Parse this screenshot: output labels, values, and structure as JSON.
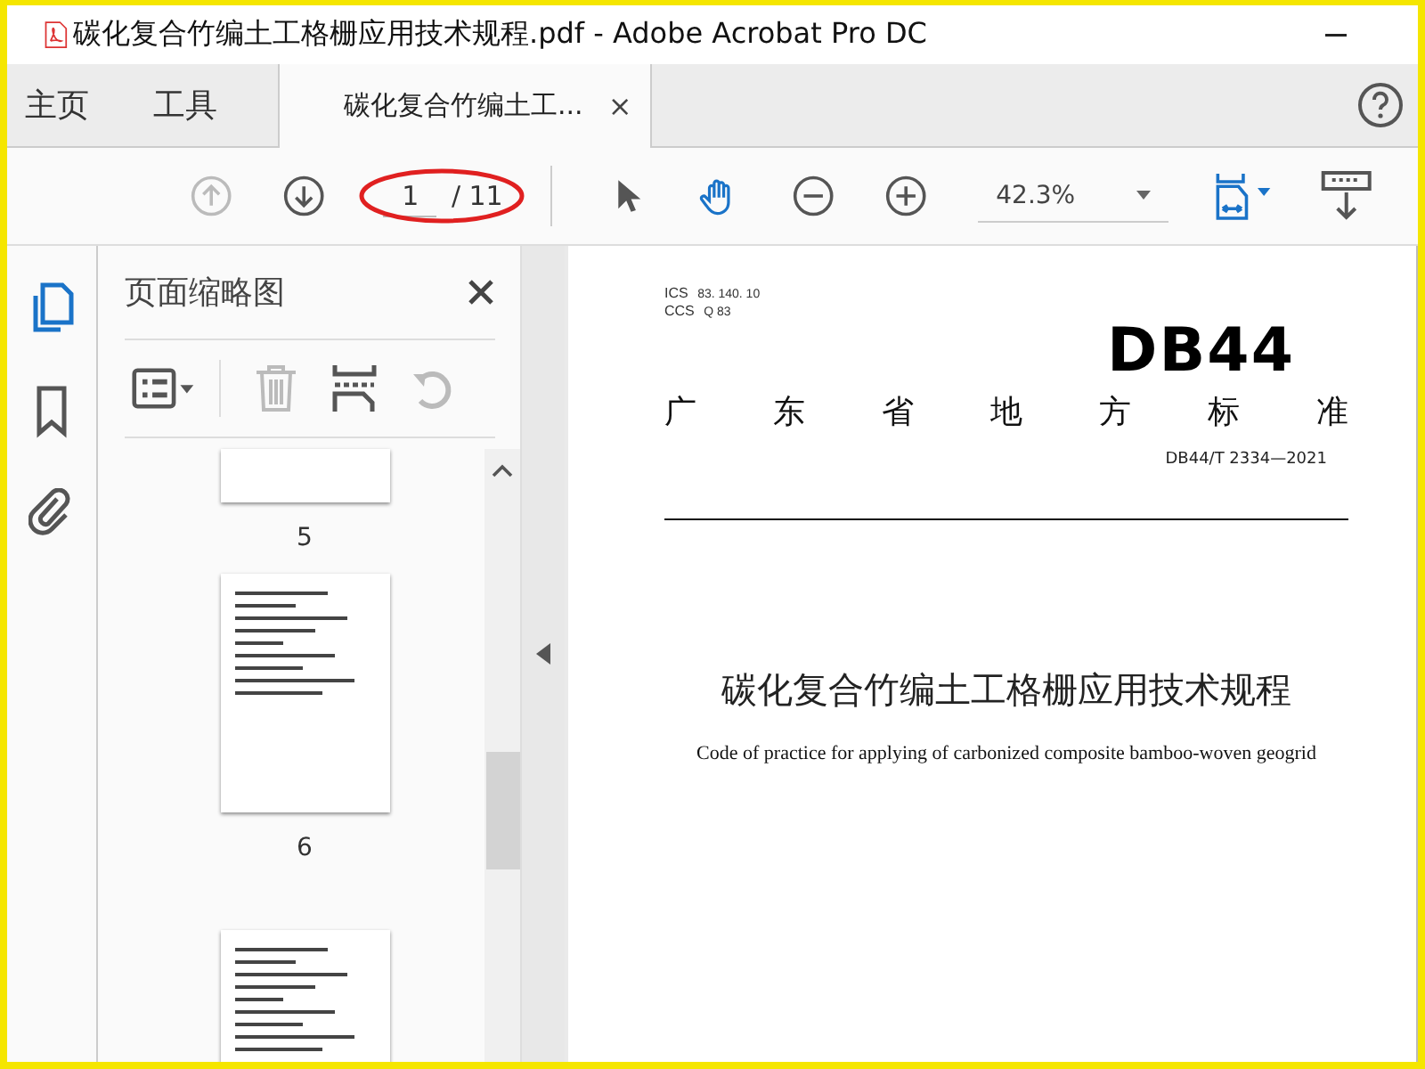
{
  "window": {
    "title": "碳化复合竹编土工格栅应用技术规程.pdf - Adobe Acrobat Pro DC"
  },
  "tabs": [
    {
      "kind": "nav",
      "label": "主页",
      "selected": false
    },
    {
      "kind": "nav",
      "label": "工具",
      "selected": false
    },
    {
      "kind": "document",
      "label": "碳化复合竹编土工...",
      "close": "×",
      "selected": true
    }
  ],
  "toolbar": {
    "prev_disabled": true,
    "page_current": "1",
    "page_total": "/ 11",
    "zoom": "42.3%"
  },
  "rail": [
    {
      "kind": "pages",
      "selected": true
    },
    {
      "kind": "bookmark",
      "selected": false
    },
    {
      "kind": "attachment",
      "selected": false
    }
  ],
  "sidebar": {
    "title": "页面缩略图",
    "thumbnails": [
      {
        "kind": "partial-top",
        "label": "5"
      },
      {
        "kind": "full",
        "label": "6"
      },
      {
        "kind": "partial-bottom"
      }
    ]
  },
  "document": {
    "ics_label": "ICS",
    "ics_value": "83. 140. 10",
    "ccs_label": "CCS",
    "ccs_value": "Q 83",
    "logo": "DB44",
    "category": [
      "广",
      "东",
      "省",
      "地",
      "方",
      "标",
      "准"
    ],
    "number": "DB44/T 2334—2021",
    "title": "碳化复合竹编土工格栅应用技术规程",
    "subtitle": "Code of practice for applying of carbonized composite bamboo-woven geogrid"
  }
}
